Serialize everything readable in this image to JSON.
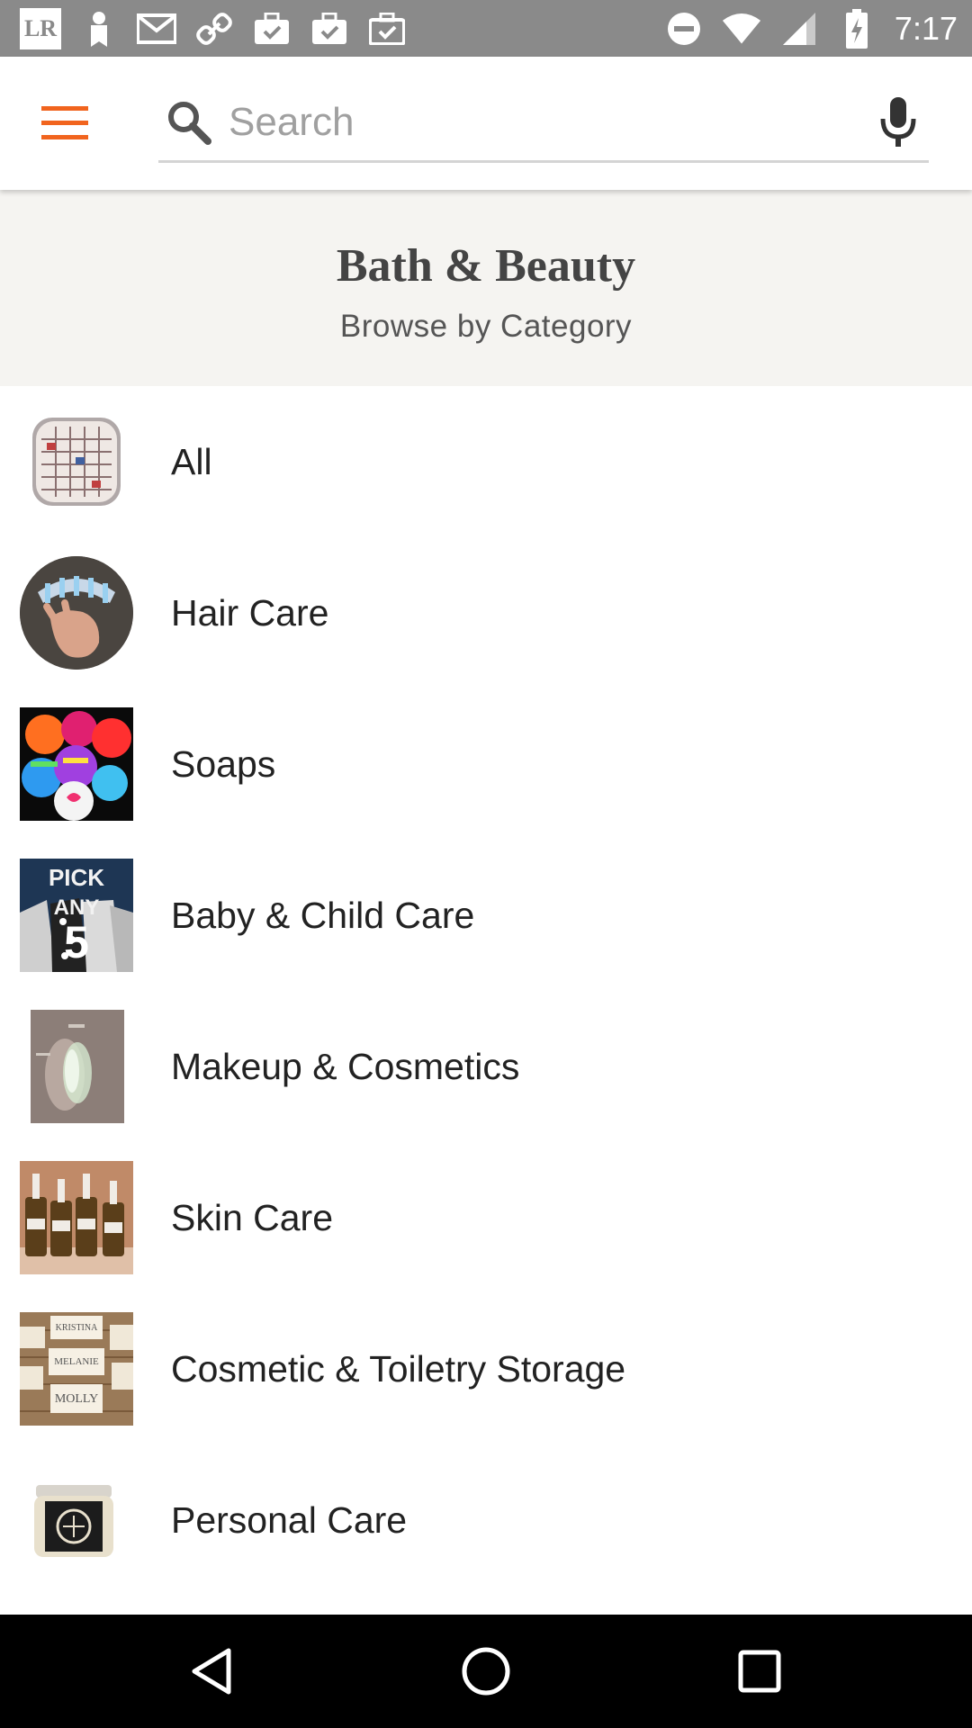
{
  "status_bar": {
    "time": "7:17",
    "left_badge": "LR",
    "left_icons": [
      "lr-icon",
      "bookmark-icon",
      "gmail-icon",
      "link-icon",
      "briefcase-check-icon",
      "briefcase-check-icon",
      "briefcase-check-icon"
    ],
    "right_icons": [
      "do-not-disturb-icon",
      "wifi-icon",
      "signal-icon",
      "battery-charging-icon"
    ]
  },
  "app_bar": {
    "menu_icon": "hamburger-menu-icon",
    "search_placeholder": "Search",
    "search_value": "",
    "search_icon": "search-icon",
    "mic_icon": "microphone-icon",
    "accent_color": "#f1641e"
  },
  "header": {
    "title": "Bath & Beauty",
    "subtitle": "Browse by Category"
  },
  "categories": [
    {
      "label": "All",
      "thumb": "compact-mirror-image"
    },
    {
      "label": "Hair Care",
      "thumb": "hair-clips-hand-image"
    },
    {
      "label": "Soaps",
      "thumb": "bath-bombs-image"
    },
    {
      "label": "Baby & Child Care",
      "thumb": "pick-any-5-bibs-image"
    },
    {
      "label": "Makeup & Cosmetics",
      "thumb": "shimmer-swatch-image"
    },
    {
      "label": "Skin Care",
      "thumb": "oil-bottles-image"
    },
    {
      "label": "Cosmetic & Toiletry Storage",
      "thumb": "name-tags-image"
    },
    {
      "label": "Personal Care",
      "thumb": "jar-image"
    }
  ],
  "thumb_texts": {
    "pick": "PICK",
    "any": "ANY",
    "five": "5",
    "tag1": "KRISTINA",
    "tag2": "MELANIE",
    "tag3": "MOLLY"
  },
  "nav_bar": {
    "back_icon": "back-triangle-icon",
    "home_icon": "home-circle-icon",
    "recents_icon": "recents-square-icon"
  }
}
